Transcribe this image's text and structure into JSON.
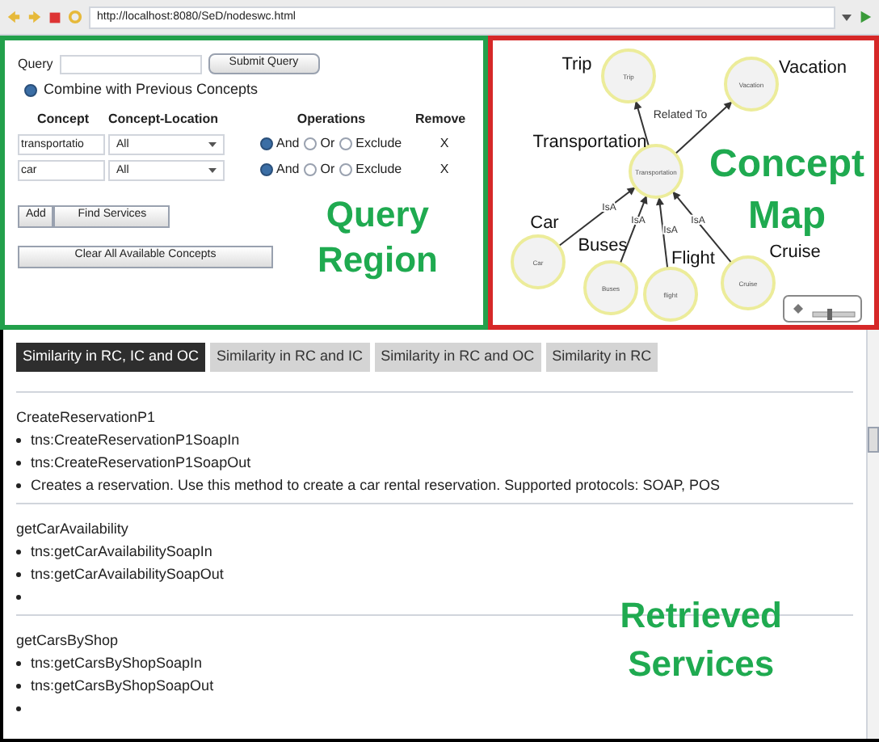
{
  "browser": {
    "url": "http://localhost:8080/SeD/nodeswc.html"
  },
  "query_panel": {
    "query_label": "Query",
    "submit": "Submit Query",
    "combine": {
      "label": "Combine with Previous Concepts",
      "selected": true
    },
    "columns": [
      "Concept",
      "Concept-Location",
      "Operations",
      "Remove"
    ],
    "rows": [
      {
        "concept": "transportatio",
        "location": "All",
        "operations": [
          {
            "label": "And",
            "selected": true
          },
          {
            "label": "Or",
            "selected": false
          },
          {
            "label": "Exclude",
            "selected": false
          }
        ],
        "remove": "X"
      },
      {
        "concept": "car",
        "location": "All",
        "operations": [
          {
            "label": "And",
            "selected": true
          },
          {
            "label": "Or",
            "selected": false
          },
          {
            "label": "Exclude",
            "selected": false
          }
        ],
        "remove": "X"
      }
    ],
    "add": "Add",
    "find": "Find Services",
    "clear": "Clear All Available Concepts",
    "annotation": [
      "Query",
      "Region"
    ]
  },
  "concept_map": {
    "nodes": [
      {
        "label": "Trip",
        "caption": "Trip"
      },
      {
        "label": "Vacation",
        "caption": "Vacation"
      },
      {
        "label": "Transportation",
        "caption": "Transportation"
      },
      {
        "label": "Car",
        "caption": "Car"
      },
      {
        "label": "Buses",
        "caption": "Buses"
      },
      {
        "label": "flight",
        "caption": "Flight"
      },
      {
        "label": "Cruise",
        "caption": "Cruise"
      }
    ],
    "edge_labels": [
      "Related To",
      "IsA",
      "IsA",
      "IsA",
      "IsA"
    ],
    "annotation": [
      "Concept",
      "Map"
    ]
  },
  "results": {
    "tabs": [
      {
        "label": "Similarity in RC, IC and OC",
        "selected": true
      },
      {
        "label": "Similarity in RC and IC",
        "selected": false
      },
      {
        "label": "Similarity in RC and OC",
        "selected": false
      },
      {
        "label": "Similarity in RC",
        "selected": false
      }
    ],
    "services": [
      {
        "name": "CreateReservationP1",
        "items": [
          {
            "kind": "text",
            "text": "tns:CreateReservationP1SoapIn"
          },
          {
            "kind": "text",
            "text": "tns:CreateReservationP1SoapOut"
          },
          {
            "kind": "text",
            "text": "Creates a reservation. Use this method to create a car rental reservation. Supported protocols: SOAP, POS"
          }
        ]
      },
      {
        "name": "getCarAvailability",
        "items": [
          {
            "kind": "text",
            "text": "tns:getCarAvailabilitySoapIn"
          },
          {
            "kind": "text",
            "text": "tns:getCarAvailabilitySoapOut"
          },
          {
            "kind": "blank"
          }
        ]
      },
      {
        "name": "getCarsByShop",
        "items": [
          {
            "kind": "text",
            "text": "tns:getCarsByShopSoapIn"
          },
          {
            "kind": "text",
            "text": "tns:getCarsByShopSoapOut"
          },
          {
            "kind": "blank"
          }
        ]
      }
    ],
    "annotation": [
      "Retrieved",
      "Services"
    ]
  }
}
